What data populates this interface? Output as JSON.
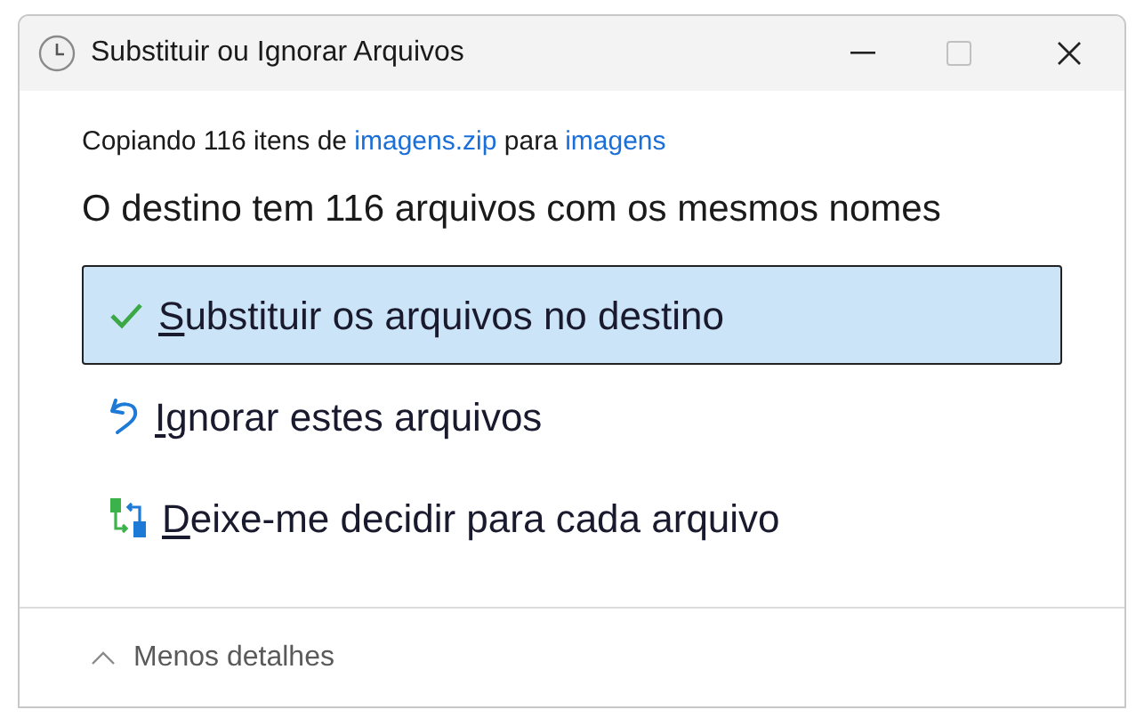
{
  "window": {
    "title": "Substituir ou Ignorar Arquivos"
  },
  "summary": [
    {
      "text": "Copiando 116 itens de ",
      "link": false
    },
    {
      "text": "imagens.zip",
      "link": true
    },
    {
      "text": " para ",
      "link": false
    },
    {
      "text": "imagens",
      "link": true
    }
  ],
  "heading": "O destino tem 116 arquivos com os mesmos nomes",
  "options": [
    {
      "kind": "replace",
      "mnemonic": "S",
      "label": "ubstituir os arquivos no destino",
      "selected": true
    },
    {
      "kind": "skip",
      "mnemonic": "I",
      "label": "gnorar estes arquivos",
      "selected": false
    },
    {
      "kind": "decide",
      "mnemonic": "D",
      "label": "eixe-me decidir para cada arquivo",
      "selected": false
    }
  ],
  "footer": {
    "label": "Menos detalhes",
    "expanded": true
  }
}
